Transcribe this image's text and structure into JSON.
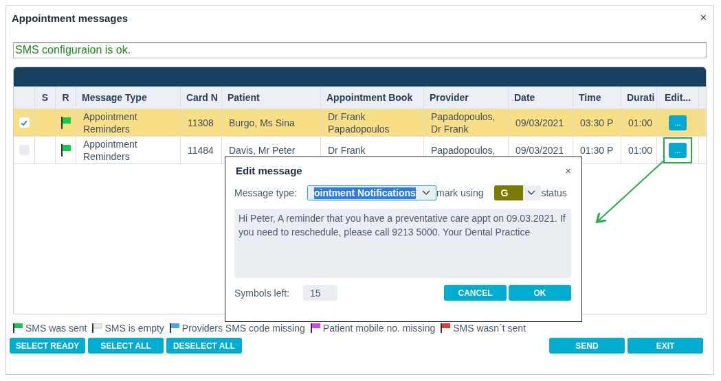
{
  "window": {
    "title": "Appointment messages",
    "close": "×"
  },
  "status_message": "SMS configuraion is ok.",
  "table": {
    "columns": [
      "S",
      "R",
      "Message Type",
      "Card N",
      "Patient",
      "Appointment Book",
      "Provider",
      "Date",
      "Time",
      "Durati",
      "Edit..."
    ],
    "rows": [
      {
        "selected": true,
        "checked": true,
        "kind": "sent",
        "message_type": "Appointment Reminders",
        "card_no": "11308",
        "patient": "Burgo, Ms Sina",
        "appointment_book": "Dr Frank Papadopoulos",
        "provider": "Papadopoulos, Dr Frank",
        "date": "09/03/2021",
        "time": "03:30 P",
        "duration": "01:00",
        "edit": "...",
        "highlighted": false
      },
      {
        "selected": false,
        "checked": false,
        "kind": "sent",
        "message_type": "Appointment Reminders",
        "card_no": "11484",
        "patient": "Davis, Mr Peter",
        "appointment_book": "Dr Frank",
        "provider": "Papadopoulos,",
        "date": "09/03/2021",
        "time": "01:30 P",
        "duration": "01:00",
        "edit": "...",
        "highlighted": true
      }
    ]
  },
  "legend": [
    {
      "label": "SMS was sent",
      "color": "#13c84a"
    },
    {
      "label": "SMS is empty",
      "color": "#e6e8ea"
    },
    {
      "label": "Providers SMS code missing",
      "color": "#4aa3f0"
    },
    {
      "label": "Patient mobile no. missing",
      "color": "#d83cf0"
    },
    {
      "label": "SMS wasn´t sent",
      "color": "#e53a2a"
    }
  ],
  "buttons_left": [
    "SELECT READY",
    "SELECT ALL",
    "DESELECT ALL"
  ],
  "buttons_right": [
    "SEND",
    "EXIT"
  ],
  "dialog": {
    "title": "Edit message",
    "close": "×",
    "message_type_label": "Message type:",
    "message_type_value": "ointment Notifications",
    "mark_label": "mark using",
    "mark_value": "G",
    "status_label": "status",
    "message": "Hi Peter, A reminder that you have a preventative care appt on 09.03.2021. If you need to reschedule, please call 9213 5000. Your Dental Practice",
    "symbols_label": "Symbols left:",
    "symbols_value": "15",
    "buttons": [
      "CANCEL",
      "OK"
    ]
  }
}
